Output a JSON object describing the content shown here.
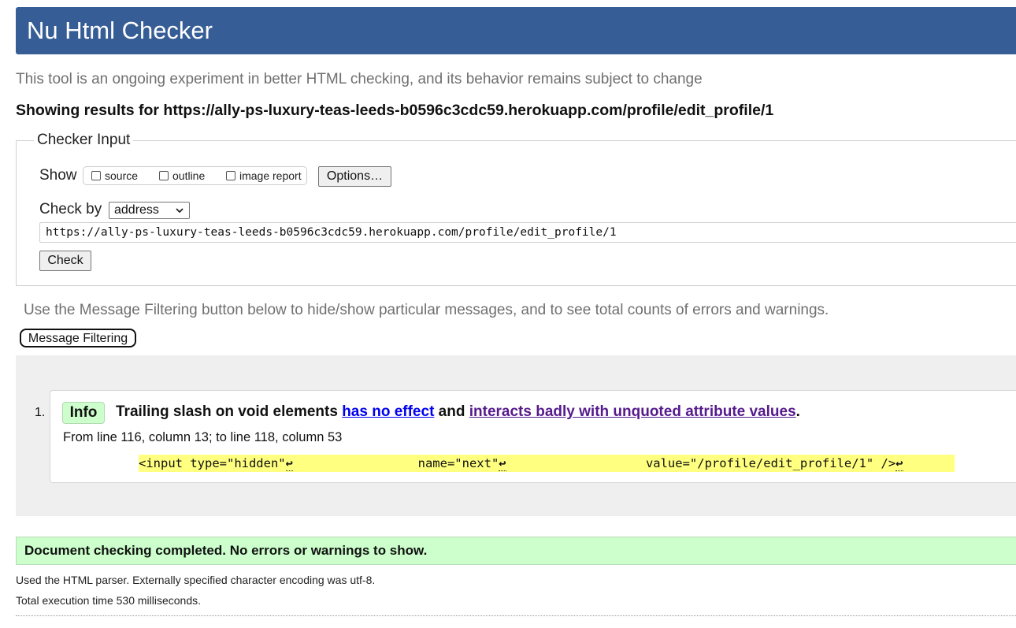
{
  "header": {
    "title": "Nu Html Checker"
  },
  "intro": "This tool is an ongoing experiment in better HTML checking, and its behavior remains subject to change",
  "results_for": "Showing results for https://ally-ps-luxury-teas-leeds-b0596c3cdc59.herokuapp.com/profile/edit_profile/1",
  "checker_input": {
    "legend": "Checker Input",
    "show_label": "Show",
    "options": [
      {
        "label": "source",
        "checked": false
      },
      {
        "label": "outline",
        "checked": false
      },
      {
        "label": "image report",
        "checked": false
      }
    ],
    "options_button": "Options…",
    "check_by_label": "Check by",
    "check_by_value": "address",
    "address_value": "https://ally-ps-luxury-teas-leeds-b0596c3cdc59.herokuapp.com/profile/edit_profile/1",
    "check_button": "Check"
  },
  "filtering": {
    "note": "Use the Message Filtering button below to hide/show particular messages, and to see total counts of errors and warnings.",
    "button": "Message Filtering"
  },
  "messages": [
    {
      "number": "1.",
      "badge": "Info",
      "text_before": "Trailing slash on void elements ",
      "link1": "has no effect",
      "text_mid": " and ",
      "link2": "interacts badly with unquoted attribute values",
      "text_after": ".",
      "location": "From line 116, column 13; to line 118, column 53",
      "extract": {
        "part1": "<input type=\"hidden\"",
        "gap1": "                 ",
        "part2": "name=\"next\"",
        "gap2": "                   ",
        "part3": "value=\"/profile/edit_profile/1\" />",
        "lf_symbol": "↩"
      }
    }
  ],
  "summary": "Document checking completed. No errors or warnings to show.",
  "footer": {
    "parser_note": "Used the HTML parser. Externally specified character encoding was utf-8.",
    "timing": "Total execution time 530 milliseconds."
  },
  "colors": {
    "header_bg": "#365d95",
    "info_badge_bg": "#ccffcc",
    "extract_highlight": "#ffff80",
    "success_bg": "#ccffcc"
  }
}
